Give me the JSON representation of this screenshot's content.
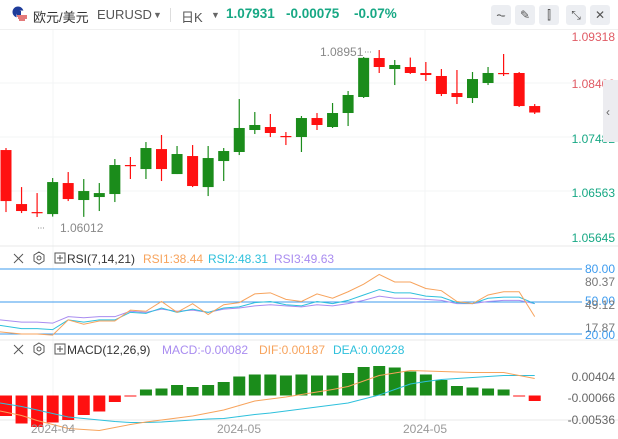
{
  "header": {
    "pair_cn": "欧元/美元",
    "symbol": "EURUSD",
    "period": "日K",
    "price": "1.07931",
    "change": "-0.00075",
    "change_pct": "-0.07%",
    "buttons": [
      {
        "icon": "line-chart-icon",
        "glyph": "⏦"
      },
      {
        "icon": "draw-pen-icon",
        "glyph": "✎"
      },
      {
        "icon": "candlestick-icon",
        "glyph": "⫿"
      },
      {
        "icon": "shrink-icon",
        "glyph": "⤡"
      },
      {
        "icon": "close-icon",
        "glyph": "✕"
      }
    ]
  },
  "colors": {
    "up": "#1b8c1b",
    "down": "#ff1010",
    "accent": "#17a884",
    "rsi1": "#f7a35c",
    "rsi2": "#2ec0dc",
    "rsi3": "#a98cf0",
    "level": "#3d9bee"
  },
  "price_axis": {
    "labels": [
      "1.09318",
      "1.08400",
      "1.07482",
      "1.06563",
      "1.05645"
    ],
    "high_label": "1.08951",
    "low_label": "1.06012"
  },
  "x_axis": {
    "labels": [
      "2024-04",
      "2024-05",
      "2024-05"
    ]
  },
  "chart_data": {
    "type": "candlestick",
    "candles": [
      [
        1.07242,
        1.07279,
        1.06103,
        1.06305
      ],
      [
        1.0625,
        1.06562,
        1.06085,
        1.06122
      ],
      [
        1.06103,
        1.06452,
        1.06012,
        1.06085
      ],
      [
        1.06066,
        1.06728,
        1.0602,
        1.06654
      ],
      [
        1.06636,
        1.06838,
        1.06305,
        1.06342
      ],
      [
        1.06324,
        1.06709,
        1.06015,
        1.06489
      ],
      [
        1.06379,
        1.06636,
        1.06122,
        1.06452
      ],
      [
        1.06434,
        1.07077,
        1.06287,
        1.06967
      ],
      [
        1.06967,
        1.07114,
        1.0671,
        1.06948
      ],
      [
        1.06893,
        1.07389,
        1.0671,
        1.07279
      ],
      [
        1.0726,
        1.07518,
        1.06673,
        1.06893
      ],
      [
        1.06801,
        1.07316,
        1.06801,
        1.07169
      ],
      [
        1.07132,
        1.07334,
        1.06562,
        1.06581
      ],
      [
        1.06562,
        1.07316,
        1.06397,
        1.07095
      ],
      [
        1.0704,
        1.07279,
        1.06673,
        1.07224
      ],
      [
        1.07206,
        1.08179,
        1.0715,
        1.07647
      ],
      [
        1.0761,
        1.0794,
        1.07536,
        1.07702
      ],
      [
        1.07665,
        1.07904,
        1.07481,
        1.07555
      ],
      [
        1.075,
        1.07573,
        1.07334,
        1.07481
      ],
      [
        1.07481,
        1.07867,
        1.07206,
        1.0783
      ],
      [
        1.0783,
        1.07922,
        1.0761,
        1.07702
      ],
      [
        1.07665,
        1.08106,
        1.07647,
        1.07922
      ],
      [
        1.07922,
        1.08326,
        1.07683,
        1.08253
      ],
      [
        1.08216,
        1.08951,
        1.08198,
        1.08935
      ],
      [
        1.08932,
        1.09079,
        1.08657,
        1.08767
      ],
      [
        1.0873,
        1.08896,
        1.08436,
        1.08804
      ],
      [
        1.08767,
        1.0894,
        1.0864,
        1.08657
      ],
      [
        1.08657,
        1.08859,
        1.0851,
        1.0862
      ],
      [
        1.08602,
        1.0873,
        1.08234,
        1.08271
      ],
      [
        1.08289,
        1.08712,
        1.08087,
        1.08216
      ],
      [
        1.08197,
        1.08675,
        1.08106,
        1.08546
      ],
      [
        1.08473,
        1.08767,
        1.08436,
        1.08657
      ],
      [
        1.08657,
        1.09006,
        1.08602,
        1.08638
      ],
      [
        1.08657,
        1.08675,
        1.08032,
        1.0805
      ],
      [
        1.0805,
        1.08087,
        1.07904,
        1.07931
      ]
    ],
    "candle_format": [
      "open",
      "high",
      "low",
      "close"
    ],
    "ylim": [
      1.05645,
      1.09318
    ],
    "rsi": {
      "title": "RSI(7,14,21)",
      "rsi1_label": "RSI1:38.44",
      "rsi2_label": "RSI2:48.31",
      "rsi3_label": "RSI3:49.63",
      "levels": [
        "80.00",
        "50.00",
        "20.00"
      ],
      "axis_labels": [
        "80.37",
        "49.12",
        "17.87"
      ],
      "rsi1": [
        22,
        20,
        20,
        19,
        33,
        29,
        32,
        32,
        42,
        41,
        50,
        40,
        48,
        38,
        47,
        49,
        57,
        58,
        52,
        50,
        57,
        53,
        59,
        66,
        75,
        68,
        68,
        62,
        60,
        50,
        48,
        56,
        59,
        59,
        36
      ],
      "rsi2": [
        28,
        25,
        25,
        24,
        33,
        31,
        33,
        33,
        40,
        39,
        44,
        40,
        43,
        40,
        44,
        45,
        49,
        50,
        47,
        46,
        50,
        48,
        51,
        56,
        61,
        58,
        58,
        55,
        54,
        49,
        48,
        53,
        54,
        54,
        48
      ],
      "rsi3": [
        33,
        31,
        31,
        30,
        36,
        35,
        36,
        36,
        41,
        40,
        43,
        41,
        42,
        40,
        43,
        44,
        46,
        47,
        46,
        45,
        47,
        46,
        48,
        51,
        55,
        53,
        53,
        52,
        51,
        48,
        48,
        50,
        51,
        51,
        48
      ]
    },
    "macd": {
      "title": "MACD(12,26,9)",
      "macd_label": "MACD:-0.00082",
      "dif_label": "DIF:0.00187",
      "dea_label": "DEA:0.00228",
      "axis_labels": [
        "0.00404",
        "-0.00066",
        "-0.00536"
      ],
      "hist_e3": [
        -4.1,
        -5.6,
        -6.3,
        -5.4,
        -4.9,
        -3.9,
        -3.2,
        -1.3,
        -0.2,
        1.2,
        1.4,
        2.1,
        1.7,
        2.1,
        2.7,
        3.8,
        4.2,
        4.2,
        4.0,
        4.2,
        4.0,
        4.0,
        4.5,
        5.7,
        5.9,
        5.6,
        4.8,
        4.2,
        3.1,
        1.9,
        1.6,
        1.4,
        1.2,
        -0.1,
        -1.1
      ],
      "dif_e3": [
        -3.1,
        -4.0,
        -5.0,
        -5.8,
        -6.6,
        -6.8,
        -7.0,
        -6.4,
        -5.8,
        -5.3,
        -4.9,
        -4.5,
        -4.1,
        -3.5,
        -2.9,
        -2.0,
        -1.1,
        -0.7,
        -0.3,
        0.2,
        0.7,
        1.2,
        1.8,
        2.9,
        4.0,
        4.5,
        5.0,
        4.9,
        4.8,
        4.7,
        4.6,
        4.6,
        4.6,
        4.0,
        3.4
      ],
      "dea_e3": [
        -1.5,
        -2.2,
        -2.9,
        -3.6,
        -4.3,
        -4.6,
        -4.9,
        -5.2,
        -5.4,
        -5.4,
        -5.3,
        -5.1,
        -4.9,
        -4.7,
        -4.6,
        -4.2,
        -3.8,
        -3.5,
        -3.1,
        -2.7,
        -2.3,
        -1.9,
        -1.5,
        -0.7,
        0.1,
        1.2,
        2.3,
        2.8,
        3.2,
        3.4,
        3.6,
        3.8,
        4.0,
        4.0,
        4.0
      ]
    }
  }
}
